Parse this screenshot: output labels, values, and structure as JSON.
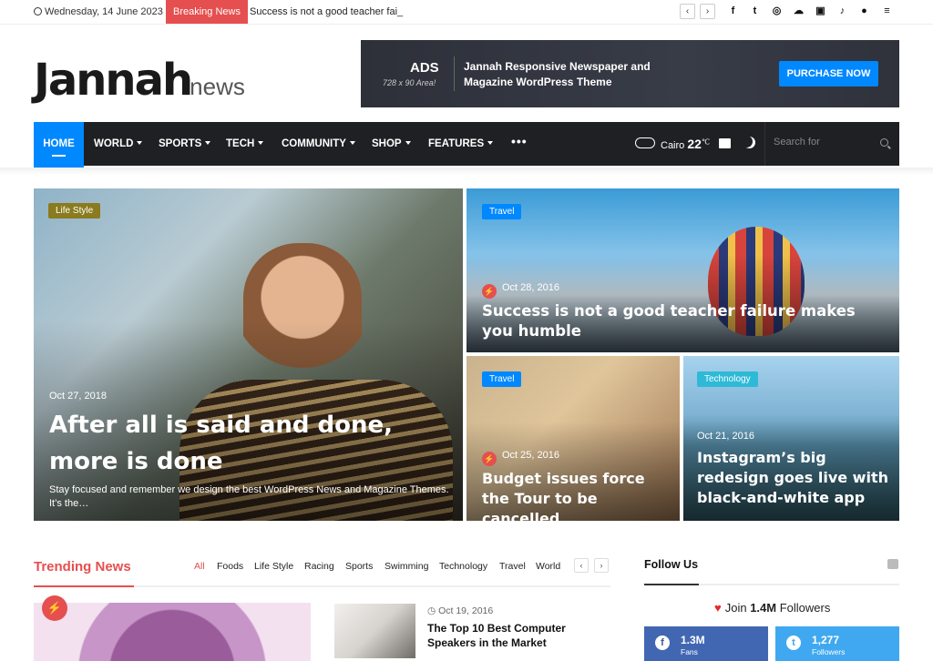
{
  "topbar": {
    "date": "Wednesday, 14 June 2023",
    "breaking_label": "Breaking News",
    "ticker_text": "Success is not a good teacher fai_",
    "prev_icon": "chevron-left-icon",
    "next_icon": "chevron-right-icon",
    "social_icons": [
      "facebook-icon",
      "twitter-icon",
      "dribbble-icon",
      "soundcloud-icon",
      "instagram-icon",
      "tiktok-icon",
      "user-icon",
      "menu-icon"
    ]
  },
  "logo": {
    "main": "Jannah",
    "suffix": "news"
  },
  "ad": {
    "title": "ADS",
    "size": "728 x 90 Area!",
    "description": "Jannah Responsive Newspaper and Magazine WordPress Theme",
    "button": "PURCHASE NOW"
  },
  "nav": {
    "items": [
      "HOME",
      "WORLD",
      "SPORTS",
      "TECH",
      "COMMUNITY",
      "SHOP",
      "FEATURES"
    ],
    "more": "•••",
    "weather_city": "Cairo",
    "weather_temp": "22",
    "weather_unit": "℃",
    "search_placeholder": "Search for"
  },
  "featured": [
    {
      "category": "Life Style",
      "date": "Oct 27, 2018",
      "title": "After all is said and done, more is done",
      "excerpt": "Stay focused and remember we design the best WordPress News and Magazine Themes. It’s the…"
    },
    {
      "category": "Travel",
      "date": "Oct 28, 2016",
      "title": "Success is not a good teacher failure makes you humble"
    },
    {
      "category": "Travel",
      "date": "Oct 25, 2016",
      "title": "Budget issues force the Tour to be cancelled"
    },
    {
      "category": "Technology",
      "date": "Oct 21, 2016",
      "title": "Instagram’s big redesign goes live with black-and-white app"
    }
  ],
  "trending": {
    "title": "Trending News",
    "tabs": [
      "All",
      "Foods",
      "Life Style",
      "Racing",
      "Sports",
      "Swimming",
      "Technology",
      "Travel",
      "World"
    ],
    "news_date": "Oct 19, 2016",
    "news_title": "The Top 10 Best Computer Speakers in the Market"
  },
  "follow": {
    "title": "Follow Us",
    "join_prefix": "Join",
    "join_count": "1.4M",
    "join_suffix": "Followers",
    "facebook_count": "1.3M",
    "facebook_label": "Fans",
    "twitter_count": "1,277",
    "twitter_label": "Followers"
  },
  "colors": {
    "accent_red": "#e54f4f",
    "primary_blue": "#0088ff",
    "nav_dark": "#1f2024"
  }
}
